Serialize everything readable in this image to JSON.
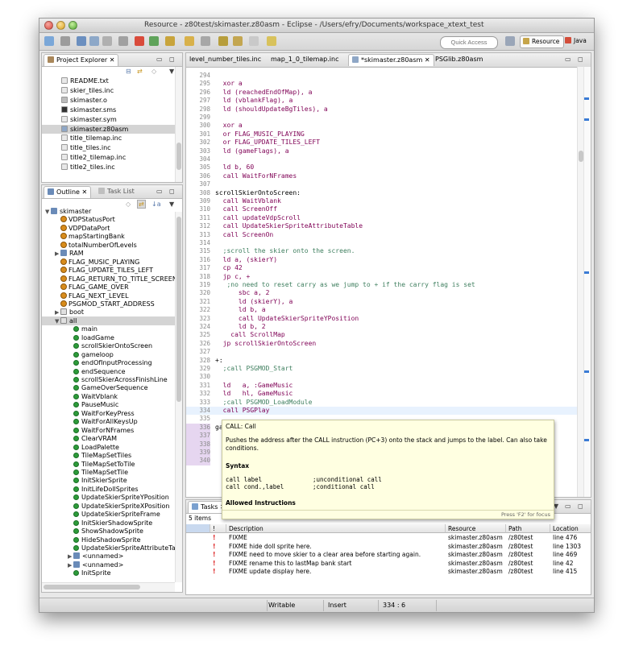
{
  "window": {
    "title": "Resource - z80test/skimaster.z80asm - Eclipse - /Users/efry/Documents/workspace_xtext_test"
  },
  "toolbar": {
    "quick_access_placeholder": "Quick Access",
    "perspectives": [
      {
        "label": "Resource",
        "active": true
      },
      {
        "label": "Java",
        "active": false
      }
    ]
  },
  "project_explorer": {
    "tab_label": "Project Explorer",
    "items": [
      {
        "label": "README.txt",
        "icon": "text-file-icon",
        "selected": false
      },
      {
        "label": "skier_tiles.inc",
        "icon": "text-file-icon",
        "selected": false
      },
      {
        "label": "skimaster.o",
        "icon": "object-file-icon",
        "selected": false
      },
      {
        "label": "skimaster.sms",
        "icon": "binary-file-icon",
        "selected": false
      },
      {
        "label": "skimaster.sym",
        "icon": "text-file-icon",
        "selected": false
      },
      {
        "label": "skimaster.z80asm",
        "icon": "asm-file-icon",
        "selected": true
      },
      {
        "label": "title_tilemap.inc",
        "icon": "text-file-icon",
        "selected": false
      },
      {
        "label": "title_tiles.inc",
        "icon": "text-file-icon",
        "selected": false
      },
      {
        "label": "title2_tilemap.inc",
        "icon": "text-file-icon",
        "selected": false
      },
      {
        "label": "title2_tiles.inc",
        "icon": "text-file-icon",
        "selected": false
      }
    ]
  },
  "outline": {
    "tabs": [
      {
        "label": "Outline",
        "active": true
      },
      {
        "label": "Task List",
        "active": false
      }
    ],
    "items": [
      {
        "label": "skimaster",
        "depth": 0,
        "kind": "root",
        "expander": "▼"
      },
      {
        "label": "VDPStatusPort",
        "depth": 1,
        "kind": "const",
        "expander": ""
      },
      {
        "label": "VDPDataPort",
        "depth": 1,
        "kind": "const",
        "expander": ""
      },
      {
        "label": "mapStartingBank",
        "depth": 1,
        "kind": "const",
        "expander": ""
      },
      {
        "label": "totalNumberOfLevels",
        "depth": 1,
        "kind": "const",
        "expander": ""
      },
      {
        "label": "RAM",
        "depth": 1,
        "kind": "section",
        "expander": "▶"
      },
      {
        "label": "FLAG_MUSIC_PLAYING",
        "depth": 1,
        "kind": "const",
        "expander": ""
      },
      {
        "label": "FLAG_UPDATE_TILES_LEFT",
        "depth": 1,
        "kind": "const",
        "expander": ""
      },
      {
        "label": "FLAG_RETURN_TO_TITLE_SCREEN",
        "depth": 1,
        "kind": "const",
        "expander": ""
      },
      {
        "label": "FLAG_GAME_OVER",
        "depth": 1,
        "kind": "const",
        "expander": ""
      },
      {
        "label": "FLAG_NEXT_LEVEL",
        "depth": 1,
        "kind": "const",
        "expander": ""
      },
      {
        "label": "PSGMOD_START_ADDRESS",
        "depth": 1,
        "kind": "const",
        "expander": ""
      },
      {
        "label": "boot",
        "depth": 1,
        "kind": "segment",
        "expander": "▶"
      },
      {
        "label": "all",
        "depth": 1,
        "kind": "segment",
        "expander": "▼",
        "selected": true
      },
      {
        "label": "main",
        "depth": 2,
        "kind": "label",
        "expander": ""
      },
      {
        "label": "loadGame",
        "depth": 2,
        "kind": "label",
        "expander": ""
      },
      {
        "label": "scrollSkierOntoScreen",
        "depth": 2,
        "kind": "label",
        "expander": ""
      },
      {
        "label": "gameloop",
        "depth": 2,
        "kind": "label",
        "expander": ""
      },
      {
        "label": "endOfInputProcessing",
        "depth": 2,
        "kind": "label",
        "expander": ""
      },
      {
        "label": "endSequence",
        "depth": 2,
        "kind": "label",
        "expander": ""
      },
      {
        "label": "scrollSkierAcrossFinishLine",
        "depth": 2,
        "kind": "label",
        "expander": ""
      },
      {
        "label": "GameOverSequence",
        "depth": 2,
        "kind": "label",
        "expander": ""
      },
      {
        "label": "WaitVblank",
        "depth": 2,
        "kind": "label",
        "expander": ""
      },
      {
        "label": "PauseMusic",
        "depth": 2,
        "kind": "label",
        "expander": ""
      },
      {
        "label": "WaitForKeyPress",
        "depth": 2,
        "kind": "label",
        "expander": ""
      },
      {
        "label": "WaitForAllKeysUp",
        "depth": 2,
        "kind": "label",
        "expander": ""
      },
      {
        "label": "WaitForNFrames",
        "depth": 2,
        "kind": "label",
        "expander": ""
      },
      {
        "label": "ClearVRAM",
        "depth": 2,
        "kind": "label",
        "expander": ""
      },
      {
        "label": "LoadPalette",
        "depth": 2,
        "kind": "label",
        "expander": ""
      },
      {
        "label": "TileMapSetTiles",
        "depth": 2,
        "kind": "label",
        "expander": ""
      },
      {
        "label": "TileMapSetToTile",
        "depth": 2,
        "kind": "label",
        "expander": ""
      },
      {
        "label": "TileMapSetTile",
        "depth": 2,
        "kind": "label",
        "expander": ""
      },
      {
        "label": "InitSkierSprite",
        "depth": 2,
        "kind": "label",
        "expander": ""
      },
      {
        "label": "InitLifeDollSprites",
        "depth": 2,
        "kind": "label",
        "expander": ""
      },
      {
        "label": "UpdateSkierSpriteYPosition",
        "depth": 2,
        "kind": "label",
        "expander": ""
      },
      {
        "label": "UpdateSkierSpriteXPosition",
        "depth": 2,
        "kind": "label",
        "expander": ""
      },
      {
        "label": "UpdateSkierSpriteFrame",
        "depth": 2,
        "kind": "label",
        "expander": ""
      },
      {
        "label": "InitSkierShadowSprite",
        "depth": 2,
        "kind": "label",
        "expander": ""
      },
      {
        "label": "ShowShadowSprite",
        "depth": 2,
        "kind": "label",
        "expander": ""
      },
      {
        "label": "HideShadowSprite",
        "depth": 2,
        "kind": "label",
        "expander": ""
      },
      {
        "label": "UpdateSkierSpriteAttributeTable",
        "depth": 2,
        "kind": "label",
        "expander": ""
      },
      {
        "label": "<unnamed>",
        "depth": 2,
        "kind": "section",
        "expander": "▶"
      },
      {
        "label": "<unnamed>",
        "depth": 2,
        "kind": "section",
        "expander": "▶"
      },
      {
        "label": "InitSprite",
        "depth": 2,
        "kind": "label",
        "expander": ""
      }
    ]
  },
  "editor": {
    "tabs": [
      {
        "label": "level_number_tiles.inc",
        "active": false
      },
      {
        "label": "map_1_0_tilemap.inc",
        "active": false
      },
      {
        "label": "*skimaster.z80asm",
        "active": true
      },
      {
        "label": "PSGlib.z80asm",
        "active": false
      }
    ],
    "lines": [
      {
        "n": "294",
        "text": "",
        "cls": ""
      },
      {
        "n": "295",
        "text": "  xor a",
        "cls": "kw"
      },
      {
        "n": "296",
        "text": "  ld (reachedEndOfMap), a",
        "cls": "kw"
      },
      {
        "n": "297",
        "text": "  ld (vblankFlag), a",
        "cls": "kw"
      },
      {
        "n": "298",
        "text": "  ld (shouldUpdateBgTiles), a",
        "cls": "kw"
      },
      {
        "n": "299",
        "text": "",
        "cls": ""
      },
      {
        "n": "300",
        "text": "  xor a",
        "cls": "kw"
      },
      {
        "n": "301",
        "text": "  or FLAG_MUSIC_PLAYING",
        "cls": "kw"
      },
      {
        "n": "302",
        "text": "  or FLAG_UPDATE_TILES_LEFT",
        "cls": "kw"
      },
      {
        "n": "303",
        "text": "  ld (gameFlags), a",
        "cls": "kw"
      },
      {
        "n": "304",
        "text": "",
        "cls": ""
      },
      {
        "n": "305",
        "text": "  ld b, 60",
        "cls": "kw"
      },
      {
        "n": "306",
        "text": "  call WaitForNFrames",
        "cls": "kw"
      },
      {
        "n": "307",
        "text": "",
        "cls": ""
      },
      {
        "n": "308",
        "text": "scrollSkierOntoScreen:",
        "cls": ""
      },
      {
        "n": "309",
        "text": "  call WaitVblank",
        "cls": "kw"
      },
      {
        "n": "310",
        "text": "  call ScreenOff",
        "cls": "kw"
      },
      {
        "n": "311",
        "text": "  call updateVdpScroll",
        "cls": "kw"
      },
      {
        "n": "312",
        "text": "  call UpdateSkierSpriteAttributeTable",
        "cls": "kw"
      },
      {
        "n": "313",
        "text": "  call ScreenOn",
        "cls": "kw"
      },
      {
        "n": "314",
        "text": "",
        "cls": ""
      },
      {
        "n": "315",
        "text": "  ;scroll the skier onto the screen.",
        "cls": "cmt"
      },
      {
        "n": "316",
        "text": "  ld a, (skierY)",
        "cls": "kw"
      },
      {
        "n": "317",
        "text": "  cp 42",
        "cls": "kw"
      },
      {
        "n": "318",
        "text": "  jp c, +",
        "cls": "kw"
      },
      {
        "n": "319",
        "text": "   ;no need to reset carry as we jump to + if the carry flag is set",
        "cls": "cmt"
      },
      {
        "n": "320",
        "text": "      sbc a, 2",
        "cls": "kw"
      },
      {
        "n": "321",
        "text": "      ld (skierY), a",
        "cls": "kw"
      },
      {
        "n": "322",
        "text": "      ld b, a",
        "cls": "kw"
      },
      {
        "n": "323",
        "text": "      call UpdateSkierSpriteYPosition",
        "cls": "kw"
      },
      {
        "n": "324",
        "text": "      ld b, 2",
        "cls": "kw"
      },
      {
        "n": "325",
        "text": "    call ScrollMap",
        "cls": "kw"
      },
      {
        "n": "326",
        "text": "  jp scrollSkierOntoScreen",
        "cls": "kw"
      },
      {
        "n": "327",
        "text": "",
        "cls": ""
      },
      {
        "n": "328",
        "text": "+:",
        "cls": ""
      },
      {
        "n": "329",
        "text": "  ;call PSGMOD_Start",
        "cls": "cmt"
      },
      {
        "n": "330",
        "text": "",
        "cls": ""
      },
      {
        "n": "331",
        "text": "  ld   a, :GameMusic",
        "cls": "kw"
      },
      {
        "n": "332",
        "text": "  ld   hl, GameMusic",
        "cls": "kw"
      },
      {
        "n": "333",
        "text": "  ;call PSGMOD_LoadModule",
        "cls": "cmt"
      },
      {
        "n": "334",
        "text": "  call PSGPlay",
        "cls": "kw"
      },
      {
        "n": "335",
        "text": "",
        "cls": ""
      },
      {
        "n": "336",
        "text": "ga",
        "cls": ""
      },
      {
        "n": "337",
        "text": "",
        "cls": ""
      },
      {
        "n": "338",
        "text": "",
        "cls": ""
      },
      {
        "n": "339",
        "text": "",
        "cls": ""
      },
      {
        "n": "340",
        "text": "",
        "cls": ""
      }
    ]
  },
  "hover_popup": {
    "title": "CALL: Call",
    "description": "Pushes the address after the CALL instruction (PC+3) onto the stack and jumps to the label. Can also take",
    "description_cont": "conditions.",
    "syntax_heading": "Syntax",
    "syntax_lines": [
      {
        "code": "call label",
        "comment": ";unconditional call"
      },
      {
        "code": "call cond.,label",
        "comment": ";conditional call"
      }
    ],
    "allowed_heading": "Allowed Instructions",
    "focus_hint": "Press 'F2' for focus"
  },
  "tasks": {
    "tab_label": "Tasks",
    "count_label": "5 items",
    "columns": [
      "!",
      "Description",
      "Resource",
      "Path",
      "Location"
    ],
    "rows": [
      {
        "description": "FIXME",
        "resource": "skimaster.z80asm",
        "path": "/z80test",
        "location": "line 476"
      },
      {
        "description": "FIXME hide doll sprite here.",
        "resource": "skimaster.z80asm",
        "path": "/z80test",
        "location": "line 1303"
      },
      {
        "description": "FIXME need to move skier to a clear area before starting again.",
        "resource": "skimaster.z80asm",
        "path": "/z80test",
        "location": "line 469"
      },
      {
        "description": "FIXME rename this to lastMap bank start",
        "resource": "skimaster.z80asm",
        "path": "/z80test",
        "location": "line 42"
      },
      {
        "description": "FIXME update display here.",
        "resource": "skimaster.z80asm",
        "path": "/z80test",
        "location": "line 415"
      }
    ]
  },
  "status_bar": {
    "mode": "Writable",
    "insert": "Insert",
    "position": "334 : 6"
  }
}
